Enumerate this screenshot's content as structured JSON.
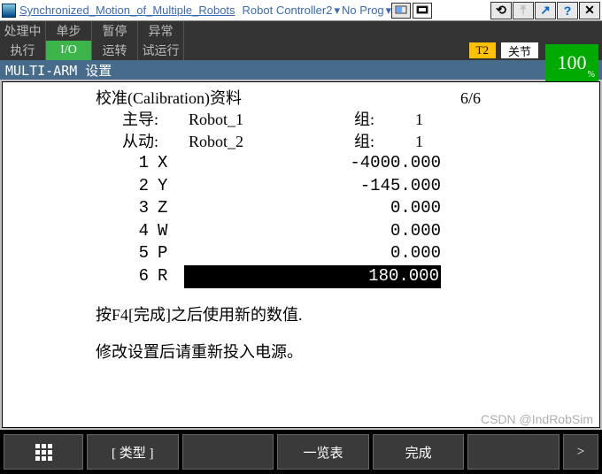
{
  "title": {
    "project": "Synchronized_Motion_of_Multiple_Robots",
    "controller": "Robot Controller2",
    "program": "No Prog"
  },
  "status": {
    "row1": [
      "处理中",
      "单步",
      "暂停",
      "异常"
    ],
    "row2": [
      "执行",
      "I/O",
      "运转",
      "试运行"
    ],
    "t2": "T2",
    "joint": "关节",
    "speed": "100",
    "speed_unit": "%"
  },
  "subheader": "MULTI-ARM 设置",
  "calib": {
    "title": "校准(Calibration)资料",
    "counter": "6/6",
    "master_label": "主导:",
    "master_name": "Robot_1",
    "slave_label": "从动:",
    "slave_name": "Robot_2",
    "group_label": "组:",
    "master_group": "1",
    "slave_group": "1"
  },
  "coords": [
    {
      "idx": "1",
      "axis": "X",
      "val": "-4000.000"
    },
    {
      "idx": "2",
      "axis": "Y",
      "val": "-145.000"
    },
    {
      "idx": "3",
      "axis": "Z",
      "val": "0.000"
    },
    {
      "idx": "4",
      "axis": "W",
      "val": "0.000"
    },
    {
      "idx": "5",
      "axis": "P",
      "val": "0.000"
    },
    {
      "idx": "6",
      "axis": "R",
      "val": "180.000"
    }
  ],
  "selected_row": 5,
  "messages": {
    "m1": "按F4[完成]之后使用新的数值.",
    "m2": "修改设置后请重新投入电源。"
  },
  "footer": {
    "type": "[ 类型 ]",
    "list": "一览表",
    "done": "完成",
    "chev": ">"
  },
  "watermark": "CSDN @IndRobSim"
}
